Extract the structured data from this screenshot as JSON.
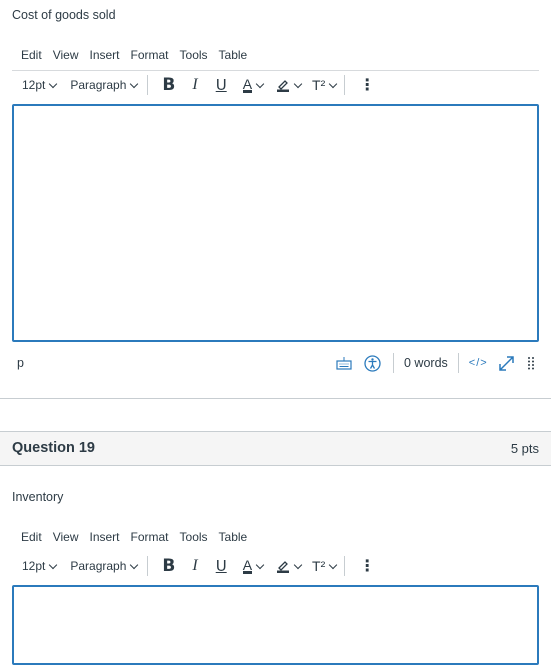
{
  "question18": {
    "prompt": "Cost of goods sold",
    "menu": [
      "Edit",
      "View",
      "Insert",
      "Format",
      "Tools",
      "Table"
    ],
    "toolbar": {
      "font_size": "12pt",
      "block_format": "Paragraph",
      "bold": "B",
      "italic": "I",
      "underline": "U",
      "text_color": "A",
      "superscript": "T²",
      "more": "⋮"
    },
    "editor_value": "",
    "status": {
      "path": "p",
      "word_count": "0 words",
      "html_toggle": "</>"
    }
  },
  "question19": {
    "title": "Question 19",
    "points": "5 pts",
    "prompt": "Inventory",
    "menu": [
      "Edit",
      "View",
      "Insert",
      "Format",
      "Tools",
      "Table"
    ],
    "toolbar": {
      "font_size": "12pt",
      "block_format": "Paragraph",
      "bold": "B",
      "italic": "I",
      "underline": "U",
      "text_color": "A",
      "superscript": "T²",
      "more": "⋮"
    },
    "editor_value": ""
  },
  "colors": {
    "accent": "#2b7abc",
    "text": "#2d3b45",
    "header_bg": "#f5f5f5",
    "border": "#c7cdd1"
  }
}
